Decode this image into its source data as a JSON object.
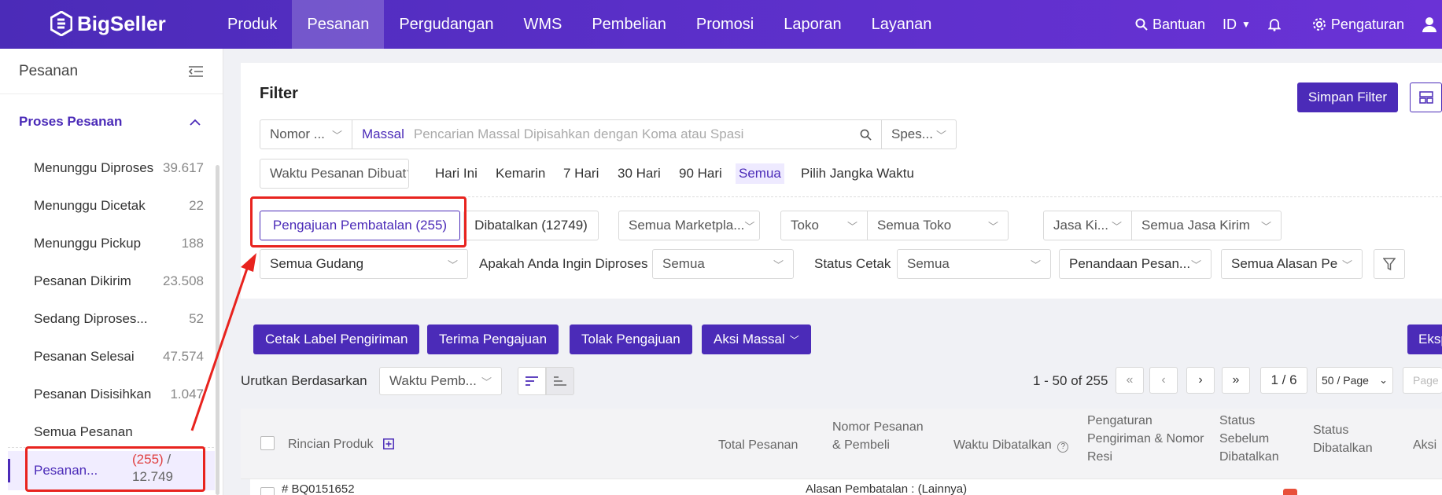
{
  "brand": {
    "name": "BigSeller",
    "accent": "#4b2bb8",
    "highlight": "#e8231e"
  },
  "nav": {
    "items": [
      "Produk",
      "Pesanan",
      "Pergudangan",
      "WMS",
      "Pembelian",
      "Promosi",
      "Laporan",
      "Layanan"
    ],
    "active": "Pesanan",
    "help": "Bantuan",
    "lang": "ID",
    "settings": "Pengaturan"
  },
  "sidebar": {
    "title": "Pesanan",
    "group": "Proses Pesanan",
    "items": [
      {
        "label": "Menunggu Diproses",
        "count": "39.617"
      },
      {
        "label": "Menunggu Dicetak",
        "count": "22"
      },
      {
        "label": "Menunggu Pickup",
        "count": "188"
      },
      {
        "label": "Pesanan Dikirim",
        "count": "23.508"
      },
      {
        "label": "Sedang Diproses...",
        "count": "52"
      },
      {
        "label": "Pesanan Selesai",
        "count": "47.574"
      },
      {
        "label": "Pesanan Disisihkan",
        "count": "1.047"
      },
      {
        "label": "Semua Pesanan",
        "count": ""
      }
    ],
    "active_item": {
      "label": "Pesanan...",
      "count_red": "(255)",
      "count_sep": " /",
      "count_total": "12.749"
    }
  },
  "filter": {
    "title": "Filter",
    "save_filter": "Simpan Filter",
    "search_field": "Nomor ...",
    "search_mode": "Massal",
    "search_placeholder": "Pencarian Massal Dipisahkan dengan Koma atau Spasi",
    "search_extra": "Spes...",
    "time_field": "Waktu Pesanan Dibuat",
    "time_options": [
      "Hari Ini",
      "Kemarin",
      "7 Hari",
      "30 Hari",
      "90 Hari",
      "Semua",
      "Pilih Jangka Waktu"
    ],
    "time_selected": "Semua",
    "status_tabs": [
      {
        "label": "Pengajuan Pembatalan (255)"
      },
      {
        "label": "Dibatalkan (12749)"
      }
    ],
    "marketplace": "Semua Marketpla...",
    "store_type": "Toko",
    "store": "Semua Toko",
    "courier_type": "Jasa Ki...",
    "courier": "Semua Jasa Kirim",
    "warehouse": "Semua Gudang",
    "process_question": "Apakah Anda Ingin Diproses",
    "process_value": "Semua",
    "print_status_label": "Status Cetak",
    "print_status_value": "Semua",
    "marking": "Penandaan Pesan...",
    "reason": "Semua Alasan Pe"
  },
  "actions": {
    "print_label": "Cetak Label Pengiriman",
    "accept": "Terima Pengajuan",
    "reject": "Tolak Pengajuan",
    "bulk": "Aksi Massal",
    "export": "Ekspo"
  },
  "sort": {
    "label": "Urutkan Berdasarkan",
    "value": "Waktu Pemb..."
  },
  "pagination": {
    "range": "1 - 50 of 255",
    "page": "1 / 6",
    "per_page": "50 / Page",
    "goto_placeholder": "Page"
  },
  "table": {
    "headers": [
      "Rincian Produk",
      "Total Pesanan",
      "Nomor Pesanan & Pembeli",
      "Waktu Dibatalkan",
      "Pengaturan Pengiriman & Nomor Resi",
      "Status Sebelum Dibatalkan",
      "Status Dibatalkan",
      "Aksi"
    ],
    "first_row_id": "# BQ0151652",
    "first_row_reason": "Alasan Pembatalan : (Lainnya)"
  }
}
